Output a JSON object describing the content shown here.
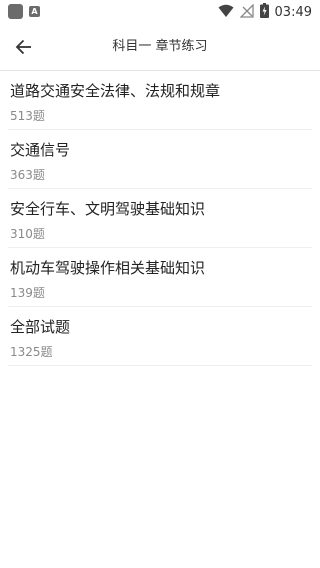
{
  "status_bar": {
    "badge_letter": "A",
    "time": "03:49"
  },
  "toolbar": {
    "title": "科目一 章节练习"
  },
  "chapters": [
    {
      "title": "道路交通安全法律、法规和规章",
      "count": "513题"
    },
    {
      "title": "交通信号",
      "count": "363题"
    },
    {
      "title": "安全行车、文明驾驶基础知识",
      "count": "310题"
    },
    {
      "title": "机动车驾驶操作相关基础知识",
      "count": "139题"
    },
    {
      "title": "全部试题",
      "count": "1325题"
    }
  ],
  "icons": {
    "back": "arrow-left-icon",
    "wifi": "wifi-icon",
    "signal": "no-signal-icon",
    "battery": "battery-charging-icon"
  },
  "colors": {
    "text_primary": "#222222",
    "text_secondary": "#8a8a8a",
    "divider": "#eeeeee"
  }
}
